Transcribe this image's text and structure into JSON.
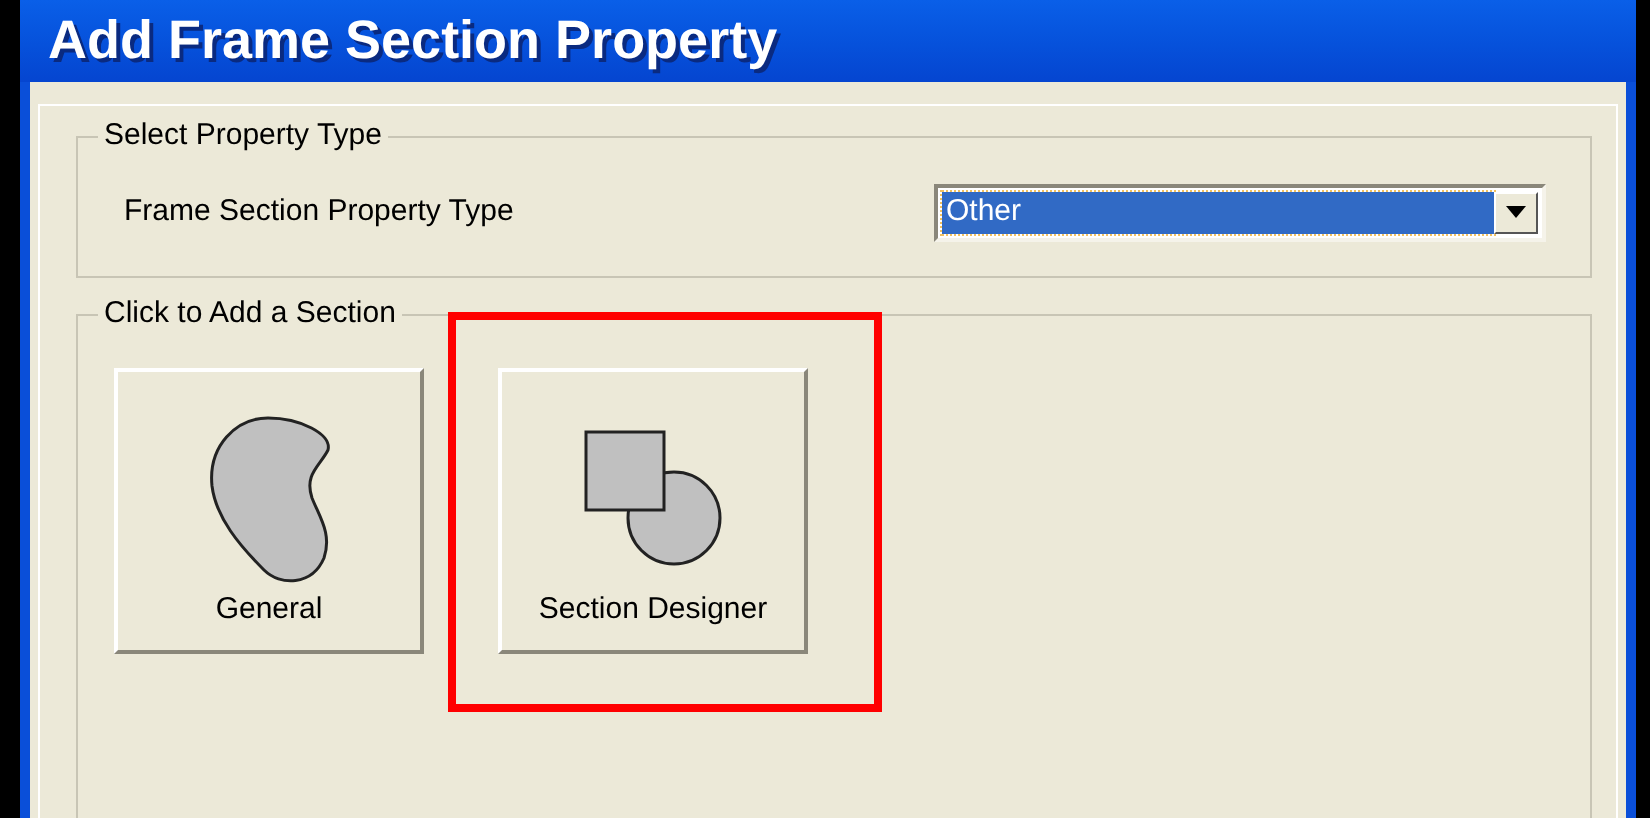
{
  "window": {
    "title": "Add Frame Section Property"
  },
  "property_type_group": {
    "title": "Select Property Type",
    "label": "Frame Section Property Type",
    "dropdown": {
      "value": "Other"
    }
  },
  "add_section_group": {
    "title": "Click to Add a Section",
    "buttons": [
      {
        "kind": "general",
        "label": "General",
        "highlighted": false
      },
      {
        "kind": "designer",
        "label": "Section Designer",
        "highlighted": true
      }
    ]
  }
}
